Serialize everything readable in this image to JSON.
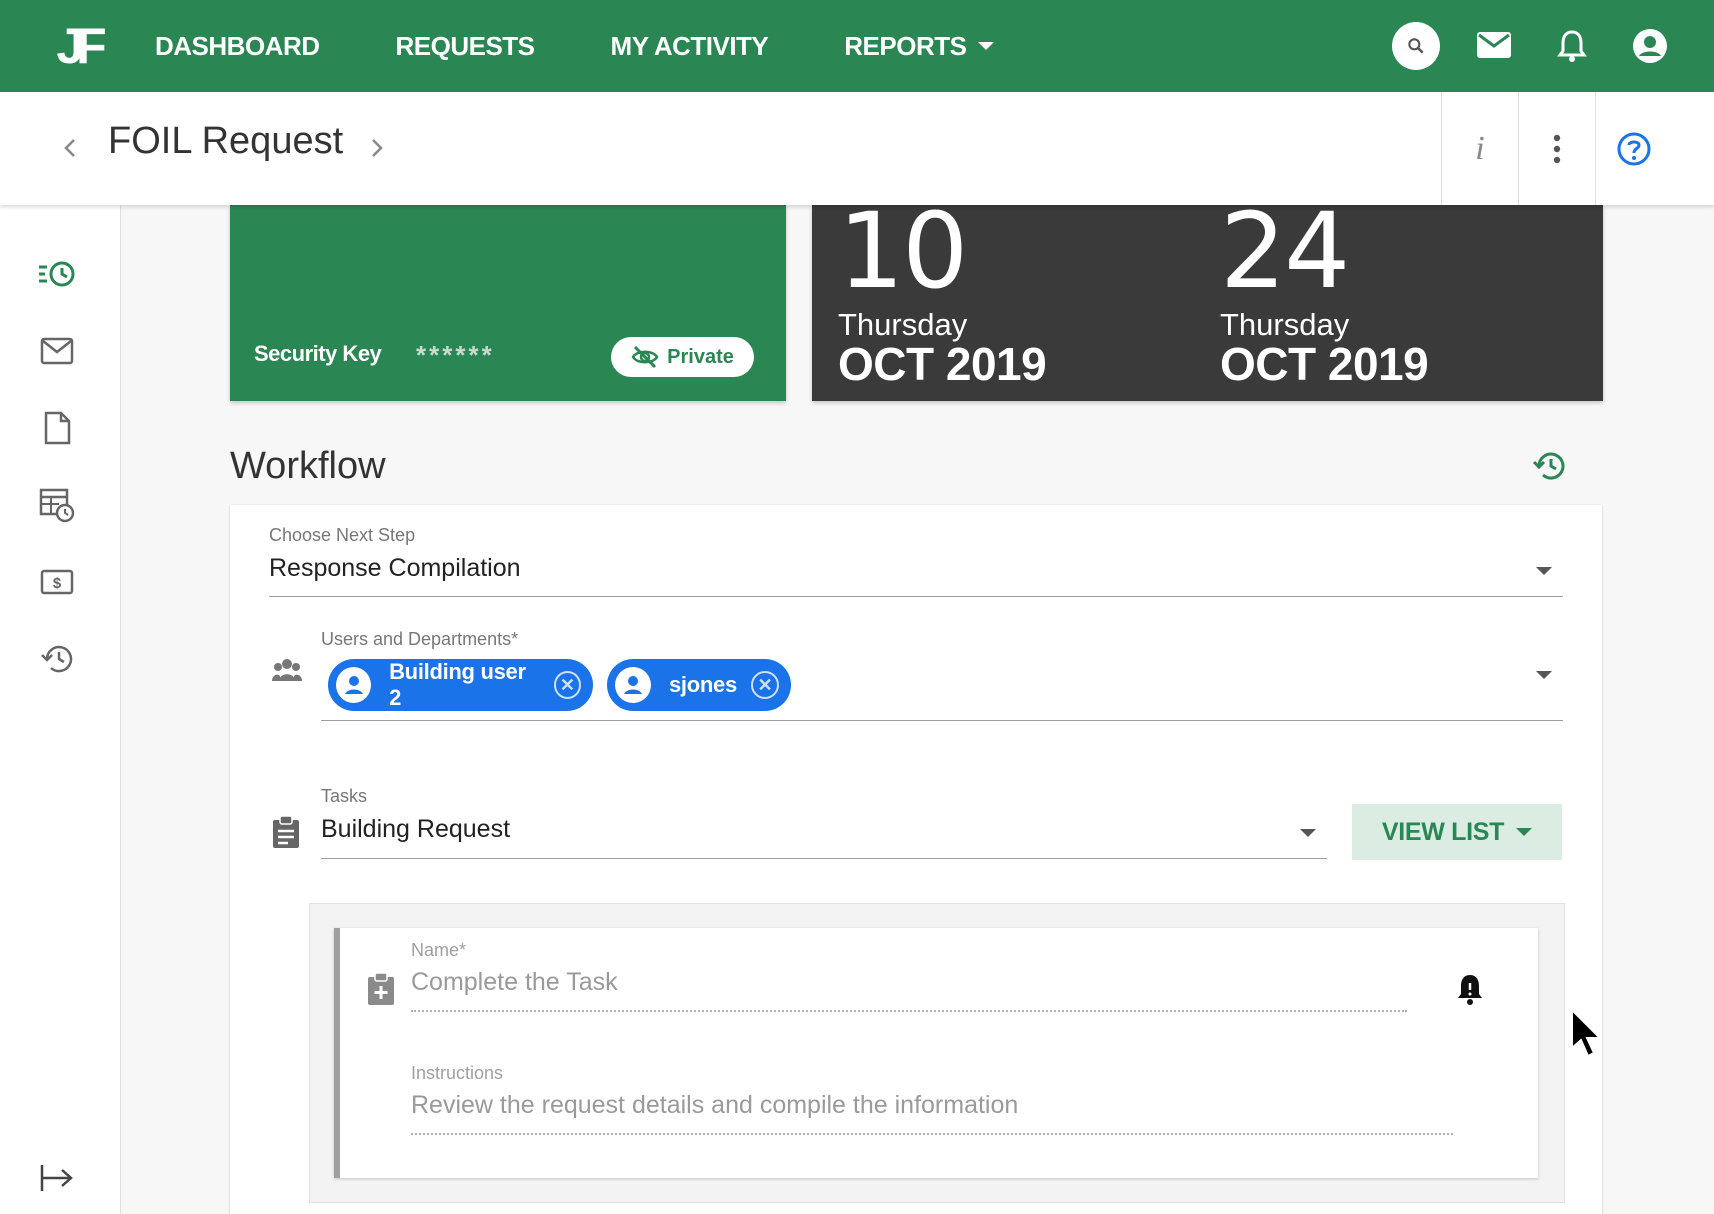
{
  "nav": {
    "logo": "JF",
    "items": [
      {
        "label": "DASHBOARD"
      },
      {
        "label": "REQUESTS"
      },
      {
        "label": "MY ACTIVITY"
      },
      {
        "label": "REPORTS"
      }
    ]
  },
  "header": {
    "title": "FOIL Request",
    "info_glyph": "i"
  },
  "security": {
    "label": "Security Key",
    "masked": "******",
    "private_label": "Private"
  },
  "dates": [
    {
      "day_num": "10",
      "weekday": "Thursday",
      "month_year": "OCT 2019"
    },
    {
      "day_num": "24",
      "weekday": "Thursday",
      "month_year": "OCT 2019"
    }
  ],
  "workflow": {
    "title": "Workflow",
    "next_step": {
      "label": "Choose Next Step",
      "value": "Response Compilation"
    },
    "users": {
      "label": "Users and Departments*",
      "chips": [
        {
          "name": "Building user 2"
        },
        {
          "name": "sjones"
        }
      ]
    },
    "tasks": {
      "label": "Tasks",
      "value": "Building Request",
      "view_list_label": "VIEW LIST"
    },
    "task_item": {
      "name_label": "Name*",
      "name_value": "Complete the Task",
      "instructions_label": "Instructions",
      "instructions_value": "Review the request details and compile the information"
    }
  },
  "colors": {
    "brand_green": "#2a8753",
    "dark_card": "#3a3a3a",
    "chip_blue": "#1a73e8",
    "help_blue": "#1a73e8"
  }
}
